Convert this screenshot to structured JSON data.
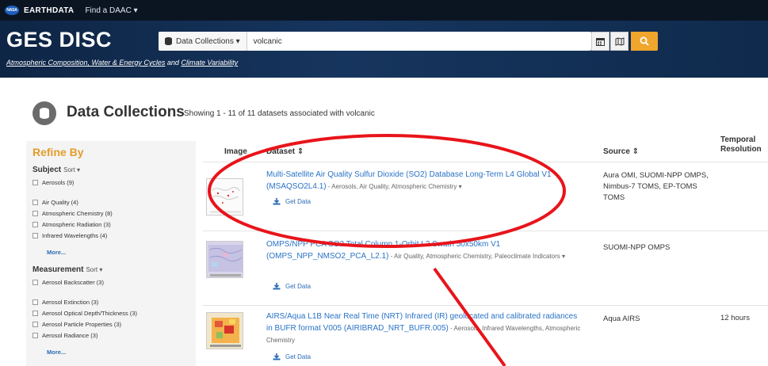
{
  "topbar": {
    "nasa_logo_text": "NASA",
    "earthdata_prefix": "EARTH",
    "earthdata_suffix": "DATA",
    "find_daac": "Find a DAAC ▾"
  },
  "header": {
    "title": "GES DISC",
    "subtitle_part1": "Atmospheric Composition, Water & Energy Cycles",
    "subtitle_and": " and ",
    "subtitle_part2": "Climate Variability",
    "collection_dropdown": "Data Collections ▾",
    "search_value": "volcanic",
    "calendar_icon": "📅",
    "map_icon": "🗺",
    "search_icon": "⚲"
  },
  "page": {
    "heading": "Data Collections",
    "count_text": "Showing 1 - 11 of 11 datasets associated with volcanic"
  },
  "sidebar": {
    "refine_by": "Refine By",
    "subject_heading": "Subject",
    "subject_sort": "Sort ▾",
    "subject_items": [
      "Aerosols (9)",
      "Air Quality (4)",
      "Atmospheric Chemistry (8)",
      "Atmospheric Radiation (3)",
      "Infrared Wavelengths (4)"
    ],
    "more_1": "More...",
    "measurement_heading": "Measurement",
    "measurement_sort": "Sort ▾",
    "measurement_items": [
      "Aerosol Backscatter (3)",
      "Aerosol Extinction (3)",
      "Aerosol Optical Depth/Thickness (3)",
      "Aerosol Particle Properties (3)",
      "Aerosol Radiance (3)"
    ],
    "more_2": "More..."
  },
  "table": {
    "col_image": "Image",
    "col_dataset": "Dataset ⇕",
    "col_source": "Source ⇕",
    "col_temporal_1": "Temporal",
    "col_temporal_2": "Resolution",
    "get_data_label": "Get Data",
    "rows": [
      {
        "title": "Multi-Satellite Air Quality Sulfur Dioxide (SO2) Database Long-Term L4 Global V1 (MSAQSO2L4.1)",
        "keywords": " - Aerosols, Air Quality, Atmospheric Chemistry ▾",
        "source": "Aura OMI, SUOMI-NPP OMPS, Nimbus-7 TOMS, EP-TOMS TOMS",
        "temporal": ""
      },
      {
        "title": "OMPS/NPP PCA SO2 Total Column 1-Orbit L2 Swath 50x50km V1 (OMPS_NPP_NMSO2_PCA_L2.1)",
        "keywords": " - Air Quality, Atmospheric Chemistry, Paleoclimate Indicators ▾",
        "source": "SUOMI-NPP OMPS",
        "temporal": ""
      },
      {
        "title": "AIRS/Aqua L1B Near Real Time (NRT) Infrared (IR) geolocated and calibrated radiances in BUFR format V005 (AIRIBRAD_NRT_BUFR.005)",
        "keywords": " - Aerosols, Infrared Wavelengths, Atmospheric Chemistry",
        "source": "Aqua AIRS",
        "temporal": "12 hours"
      }
    ]
  },
  "colors": {
    "accent_orange": "#f0a52c",
    "link_blue": "#2a73c6",
    "annotation_red": "#e8141b"
  }
}
